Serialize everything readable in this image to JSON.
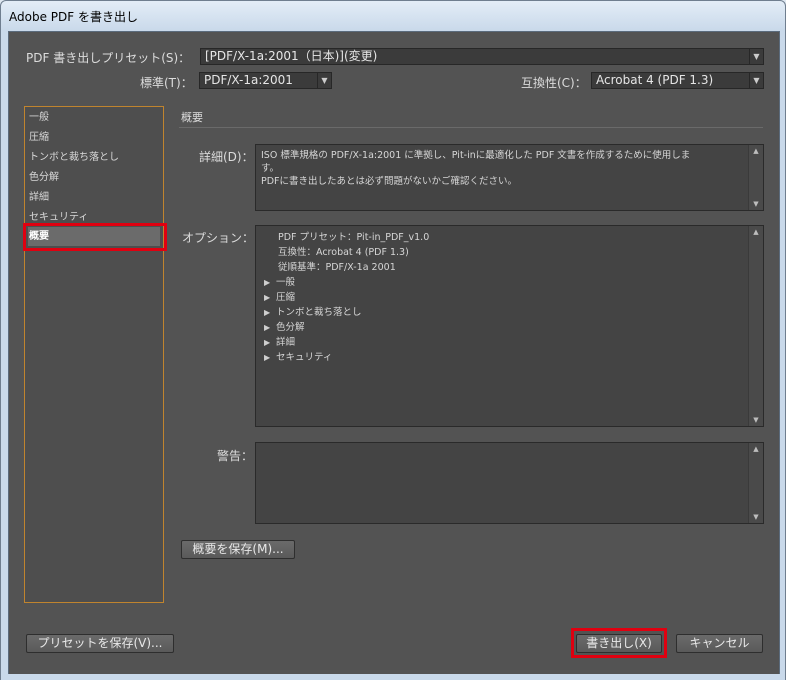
{
  "window": {
    "title": "Adobe PDF を書き出し"
  },
  "header": {
    "preset_label": "PDF 書き出しプリセット(S)：",
    "preset_value": "[PDF/X-1a:2001（日本)](変更)",
    "standard_label": "標準(T)：",
    "standard_value": "PDF/X-1a:2001",
    "compat_label": "互換性(C)：",
    "compat_value": "Acrobat 4 (PDF 1.3)"
  },
  "sidebar": {
    "items": [
      {
        "label": "一般"
      },
      {
        "label": "圧縮"
      },
      {
        "label": "トンボと裁ち落とし"
      },
      {
        "label": "色分解"
      },
      {
        "label": "詳細"
      },
      {
        "label": "セキュリティ"
      },
      {
        "label": "概要"
      }
    ]
  },
  "summary": {
    "section_title": "概要",
    "detail_label": "詳細(D)：",
    "detail_lines": [
      "ISO 標準規格の PDF/X-1a:2001 に準拠し、Pit-inに最適化した PDF 文書を作成するために使用しま",
      "す。",
      "PDFに書き出したあとは必ず問題がないかご確認ください。"
    ],
    "options_label": "オプション：",
    "options": [
      "PDF プリセット：Pit-in_PDF_v1.0",
      "互換性：Acrobat 4 (PDF 1.3)",
      "従順基準：PDF/X-1a 2001"
    ],
    "option_groups": [
      "一般",
      "圧縮",
      "トンボと裁ち落とし",
      "色分解",
      "詳細",
      "セキュリティ"
    ],
    "warning_label": "警告：",
    "save_summary_button": "概要を保存(M)..."
  },
  "footer": {
    "save_preset_button": "プリセットを保存(V)...",
    "export_button": "書き出し(X)",
    "cancel_button": "キャンセル"
  },
  "colors": {
    "panel_bg": "#535353",
    "highlight_red": "#e00010",
    "sidebar_border": "#c0842e"
  },
  "icons": [
    "dropdown-arrow-icon",
    "expand-triangle-icon",
    "scroll-up-icon",
    "scroll-down-icon"
  ]
}
